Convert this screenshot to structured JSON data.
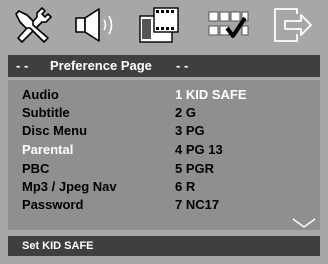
{
  "header": {
    "dash_left": "- -",
    "title": "Preference Page",
    "dash_right": "- -"
  },
  "icons": [
    {
      "name": "general-setup-icon"
    },
    {
      "name": "audio-setup-icon"
    },
    {
      "name": "video-setup-icon"
    },
    {
      "name": "preference-setup-icon"
    },
    {
      "name": "exit-icon"
    }
  ],
  "menu": {
    "items": [
      {
        "label": "Audio",
        "active": false
      },
      {
        "label": "Subtitle",
        "active": false
      },
      {
        "label": "Disc Menu",
        "active": false
      },
      {
        "label": "Parental",
        "active": true
      },
      {
        "label": "PBC",
        "active": false
      },
      {
        "label": "Mp3 / Jpeg Nav",
        "active": false
      },
      {
        "label": "Password",
        "active": false
      }
    ]
  },
  "options": {
    "items": [
      {
        "label": "1 KID SAFE",
        "active": true
      },
      {
        "label": "2 G",
        "active": false
      },
      {
        "label": "3 PG",
        "active": false
      },
      {
        "label": "4 PG 13",
        "active": false
      },
      {
        "label": "5 PGR",
        "active": false
      },
      {
        "label": "6 R",
        "active": false
      },
      {
        "label": "7 NC17",
        "active": false
      }
    ]
  },
  "status": {
    "text": "Set KID SAFE"
  },
  "colors": {
    "background": "#a7a7a7",
    "bar": "#3f3f3f",
    "panel": "#8f8f8f",
    "highlight_text": "#ffffff",
    "text": "#000000"
  }
}
